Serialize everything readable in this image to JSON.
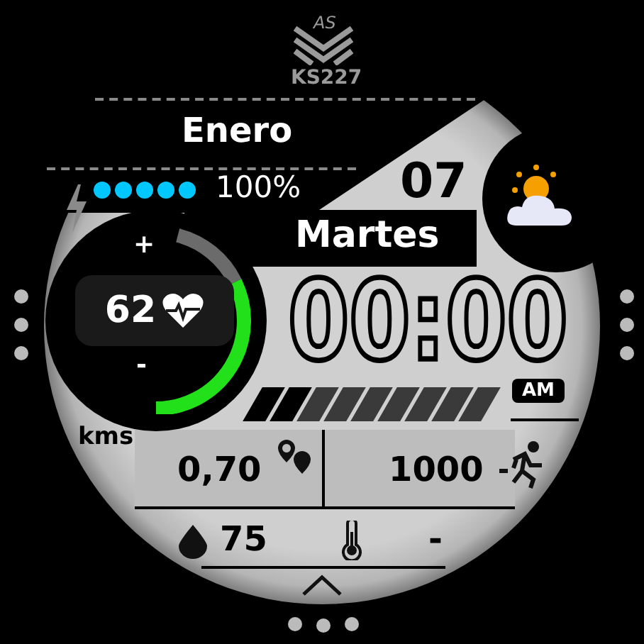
{
  "logo": {
    "monogram": "AS",
    "model": "KS227"
  },
  "month": "Enero",
  "battery": {
    "reading": "100%"
  },
  "day_number": "07",
  "weekday": "Martes",
  "heart_rate": {
    "value": "62",
    "plus": "+",
    "minus": "-"
  },
  "time": {
    "value": "00:00",
    "period": "AM"
  },
  "distance": {
    "unit": "kms",
    "value": "0,70"
  },
  "steps": "1000",
  "humidity": "75",
  "temperature": "-"
}
